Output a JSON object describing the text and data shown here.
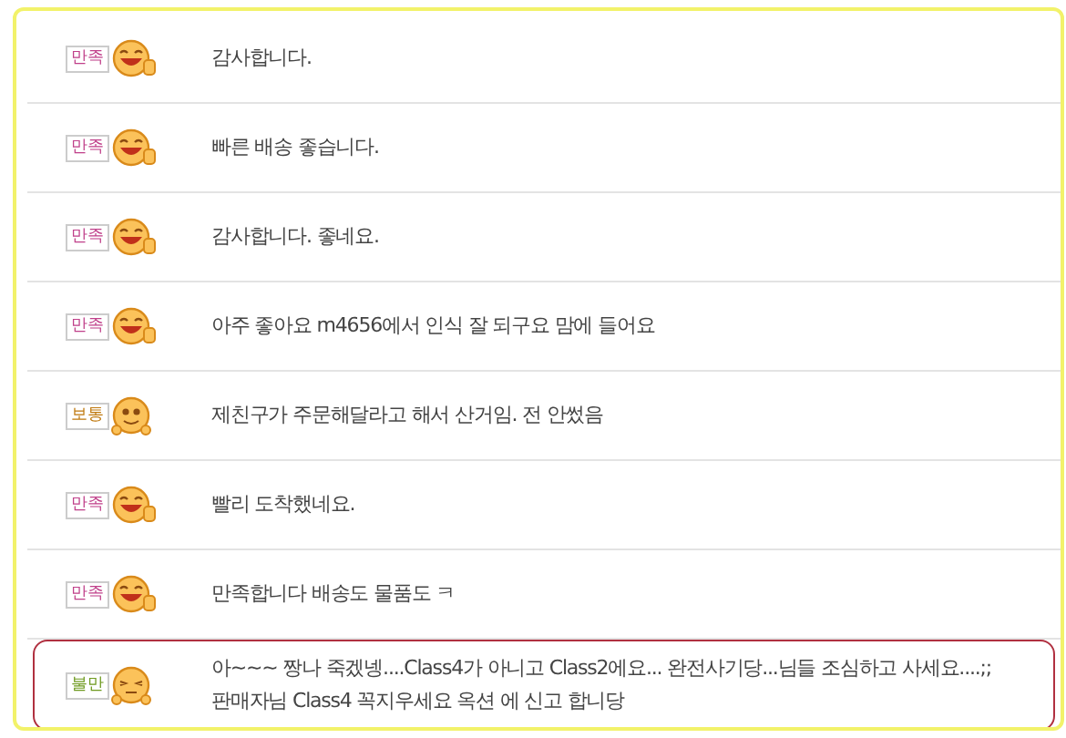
{
  "reviews": [
    {
      "rating": {
        "kind": "satisfied",
        "label": "만족"
      },
      "text": "감사합니다.",
      "highlighted": false
    },
    {
      "rating": {
        "kind": "satisfied",
        "label": "만족"
      },
      "text": "빠른 배송 좋습니다.",
      "highlighted": false
    },
    {
      "rating": {
        "kind": "satisfied",
        "label": "만족"
      },
      "text": "감사합니다. 좋네요.",
      "highlighted": false
    },
    {
      "rating": {
        "kind": "satisfied",
        "label": "만족"
      },
      "text": "아주 좋아요 m4656에서 인식 잘 되구요 맘에 들어요",
      "highlighted": false
    },
    {
      "rating": {
        "kind": "neutral",
        "label": "보통"
      },
      "text": "제친구가 주문해달라고 해서 산거임. 전 안썼음",
      "highlighted": false
    },
    {
      "rating": {
        "kind": "satisfied",
        "label": "만족"
      },
      "text": "빨리 도착했네요.",
      "highlighted": false
    },
    {
      "rating": {
        "kind": "satisfied",
        "label": "만족"
      },
      "text": "만족합니다 배송도 물품도 ㅋ",
      "highlighted": false
    },
    {
      "rating": {
        "kind": "unsatisfied",
        "label": "불만"
      },
      "text": "아~~~ 짱나 죽겠넹....Class4가 아니고 Class2에요... 완전사기당...님들 조심하고 사세요....;;\n판매자님 Class4 꼭지우세요 옥션 에 신고 합니당",
      "highlighted": true
    }
  ]
}
